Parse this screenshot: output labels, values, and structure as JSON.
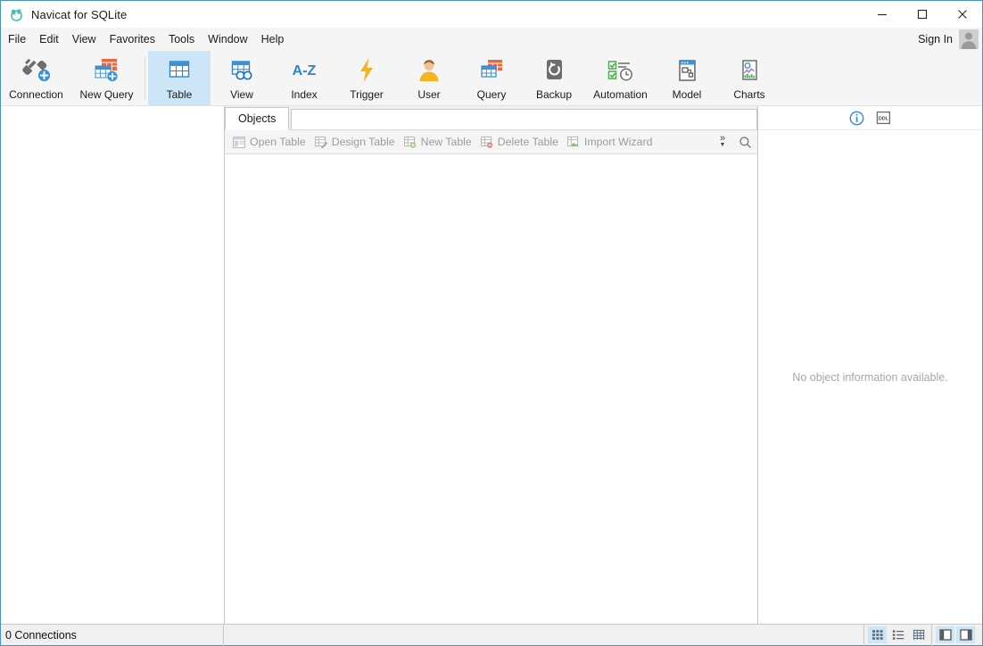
{
  "window": {
    "title": "Navicat for SQLite",
    "app_icon": "navicat-logo-icon",
    "minimize_label": "─",
    "maximize_label": "□",
    "close_label": "✕",
    "accent_color": "#4a90c4"
  },
  "menubar": {
    "items": [
      {
        "label": "File"
      },
      {
        "label": "Edit"
      },
      {
        "label": "View"
      },
      {
        "label": "Favorites"
      },
      {
        "label": "Tools"
      },
      {
        "label": "Window"
      },
      {
        "label": "Help"
      }
    ],
    "signin_label": "Sign In"
  },
  "toolbar": {
    "selected": "Table",
    "highlight_color": "#cde6f7",
    "groups": [
      {
        "buttons": [
          {
            "label": "Connection",
            "icon": "connection-icon"
          },
          {
            "label": "New Query",
            "icon": "new-query-icon"
          }
        ]
      },
      {
        "buttons": [
          {
            "label": "Table",
            "icon": "table-icon",
            "selected": true
          },
          {
            "label": "View",
            "icon": "view-icon"
          },
          {
            "label": "Index",
            "icon": "index-icon"
          },
          {
            "label": "Trigger",
            "icon": "trigger-icon"
          },
          {
            "label": "User",
            "icon": "user-icon"
          },
          {
            "label": "Query",
            "icon": "query-icon"
          },
          {
            "label": "Backup",
            "icon": "backup-icon"
          },
          {
            "label": "Automation",
            "icon": "automation-icon"
          },
          {
            "label": "Model",
            "icon": "model-icon"
          },
          {
            "label": "Charts",
            "icon": "charts-icon"
          }
        ]
      }
    ]
  },
  "center": {
    "tabs": [
      {
        "label": "Objects",
        "selected": true
      }
    ],
    "object_toolbar": {
      "buttons": [
        {
          "label": "Open Table",
          "icon": "open-table-icon"
        },
        {
          "label": "Design Table",
          "icon": "design-table-icon"
        },
        {
          "label": "New Table",
          "icon": "new-table-icon"
        },
        {
          "label": "Delete Table",
          "icon": "delete-table-icon"
        },
        {
          "label": "Import Wizard",
          "icon": "import-wizard-icon"
        }
      ],
      "overflow_label": "»",
      "overflow_caret": "▼",
      "search_icon": "search-icon"
    }
  },
  "right_panel": {
    "tools": [
      {
        "icon": "info-icon",
        "active": true,
        "color": "#2b8ae0"
      },
      {
        "icon": "ddl-icon",
        "active": false,
        "label": "DDL",
        "color": "#6b6b6b"
      }
    ],
    "empty_message": "No object information available."
  },
  "statusbar": {
    "connections_text": "0 Connections",
    "view_modes": [
      {
        "icon": "grid-view-icon",
        "active": true
      },
      {
        "icon": "list-view-icon",
        "active": false
      },
      {
        "icon": "detail-view-icon",
        "active": false
      }
    ],
    "panel_toggles": [
      {
        "icon": "left-panel-toggle-icon",
        "active": true
      },
      {
        "icon": "right-panel-toggle-icon",
        "active": true
      }
    ]
  }
}
